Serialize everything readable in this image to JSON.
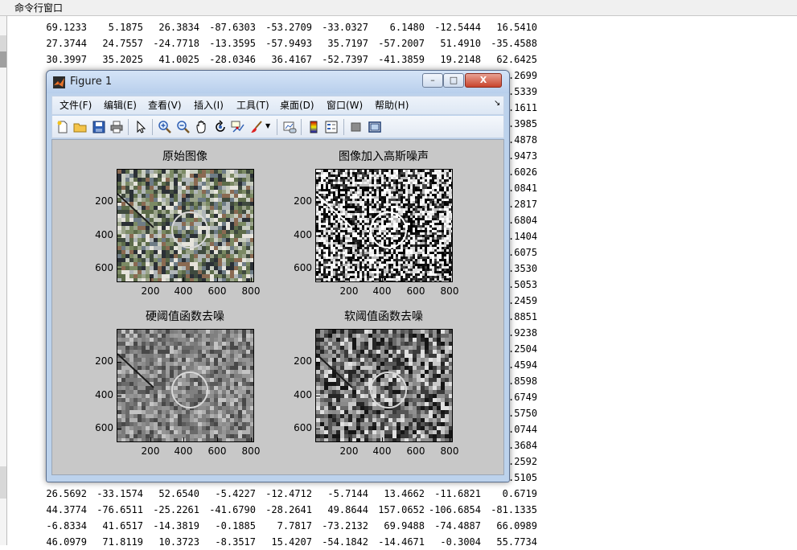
{
  "command_window": {
    "title": "命令行窗口",
    "top_rows": [
      [
        "69.1233",
        "5.1875",
        "26.3834",
        "-87.6303",
        "-53.2709",
        "-33.0327",
        "6.1480",
        "-12.5444",
        "16.5410"
      ],
      [
        "27.3744",
        "24.7557",
        "-24.7718",
        "-13.3595",
        "-57.9493",
        "35.7197",
        "-57.2007",
        "51.4910",
        "-35.4588"
      ],
      [
        "30.3997",
        "35.2025",
        "41.0025",
        "-28.0346",
        "36.4167",
        "-52.7397",
        "-41.3859",
        "19.2148",
        "62.6425"
      ]
    ],
    "right_suffixes": [
      ".2699",
      ".5339",
      ".1611",
      ".3985",
      ".4878",
      ".9473",
      ".6026",
      ".0841",
      ".2817",
      ".6804",
      ".1404",
      ".6075",
      ".3530",
      ".5053",
      ".2459",
      ".8851",
      ".9238",
      ".2504",
      ".4594",
      ".8598",
      ".6749",
      ".5750",
      ".0744",
      ".3684",
      ".2592",
      ".5105"
    ],
    "bottom_rows": [
      [
        "26.5692",
        "-33.1574",
        "52.6540",
        "-5.4227",
        "-12.4712",
        "-5.7144",
        "13.4662",
        "-11.6821",
        "0.6719"
      ],
      [
        "44.3774",
        "-76.6511",
        "-25.2261",
        "-41.6790",
        "-28.2641",
        "49.8644",
        "157.0652",
        "-106.6854",
        "-81.1335"
      ],
      [
        "-6.8334",
        "41.6517",
        "-14.3819",
        "-0.1885",
        "7.7817",
        "-73.2132",
        "69.9488",
        "-74.4887",
        "66.0989"
      ],
      [
        "46.0979",
        "71.8119",
        "10.3723",
        "-8.3517",
        "15.4207",
        "-54.1842",
        "-14.4671",
        "-0.3004",
        "55.7734"
      ]
    ]
  },
  "figure": {
    "title": "Figure 1",
    "buttons": {
      "minimize": "–",
      "maximize": "□",
      "close": "X"
    },
    "menus": [
      "文件(F)",
      "编辑(E)",
      "查看(V)",
      "插入(I)",
      "工具(T)",
      "桌面(D)",
      "窗口(W)",
      "帮助(H)"
    ],
    "menu_arrow": "↘",
    "toolbar": [
      "new-figure-icon",
      "open-icon",
      "save-icon",
      "print-icon",
      "pointer-icon",
      "zoom-in-icon",
      "zoom-out-icon",
      "pan-hand-icon",
      "rotate-3d-icon",
      "data-cursor-icon",
      "brush-icon",
      "dropdown-arrow-icon",
      "link-plot-icon",
      "colorbar-icon",
      "legend-icon",
      "hide-plot-tools-icon",
      "show-plot-tools-icon"
    ],
    "subplots": [
      {
        "title": "原始图像",
        "style": "color"
      },
      {
        "title": "图像加入高斯噪声",
        "style": "noise"
      },
      {
        "title": "硬阈值函数去噪",
        "style": "gray-soft"
      },
      {
        "title": "软阈值函数去噪",
        "style": "gray-contrast"
      }
    ],
    "y_ticks": [
      "200",
      "400",
      "600"
    ],
    "x_ticks": [
      "200",
      "400",
      "600",
      "800"
    ]
  }
}
